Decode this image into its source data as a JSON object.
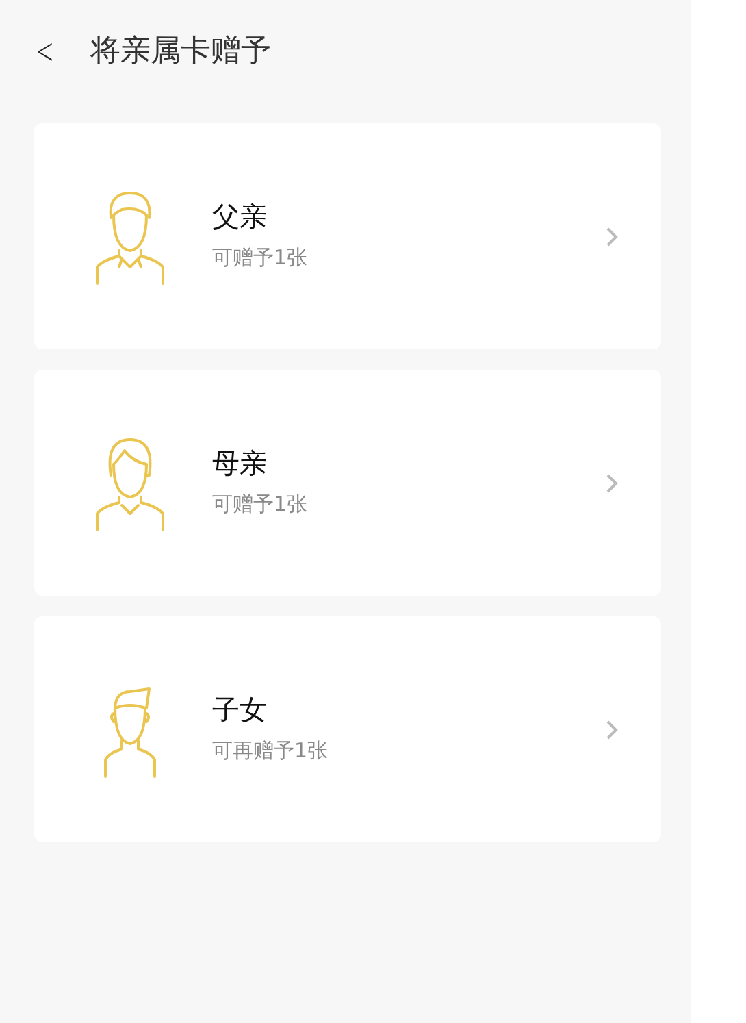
{
  "header": {
    "back": "<",
    "title": "将亲属卡赠予"
  },
  "members": [
    {
      "kind": "father",
      "name": "父亲",
      "note": "可赠予1张"
    },
    {
      "kind": "mother",
      "name": "母亲",
      "note": "可赠予1张"
    },
    {
      "kind": "child",
      "name": "子女",
      "note": "可再赠予1张"
    }
  ]
}
